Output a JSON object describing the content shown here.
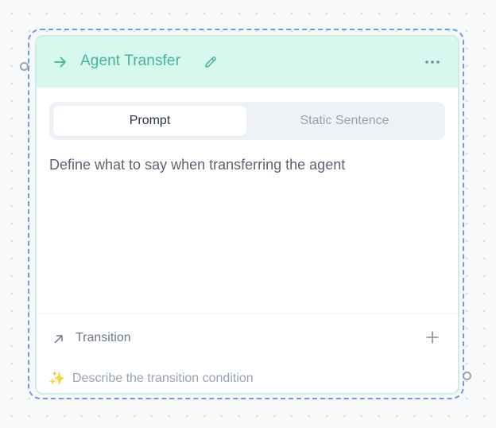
{
  "node": {
    "title": "Agent Transfer",
    "header_icon": "arrow-right-icon",
    "edit_icon": "pencil-icon",
    "more_icon": "more-horizontal-icon"
  },
  "tabs": [
    {
      "label": "Prompt",
      "active": true
    },
    {
      "label": "Static Sentence",
      "active": false
    }
  ],
  "prompt": {
    "text": "Define what to say when transferring the agent"
  },
  "transition": {
    "label": "Transition",
    "icon": "arrow-up-right-icon",
    "add_icon": "plus-icon",
    "condition_placeholder": "Describe the transition condition",
    "condition_icon": "sparkles-icon"
  },
  "colors": {
    "header_bg": "#d6f8ef",
    "accent": "#45b596",
    "selection_border": "#6f9ae6"
  }
}
